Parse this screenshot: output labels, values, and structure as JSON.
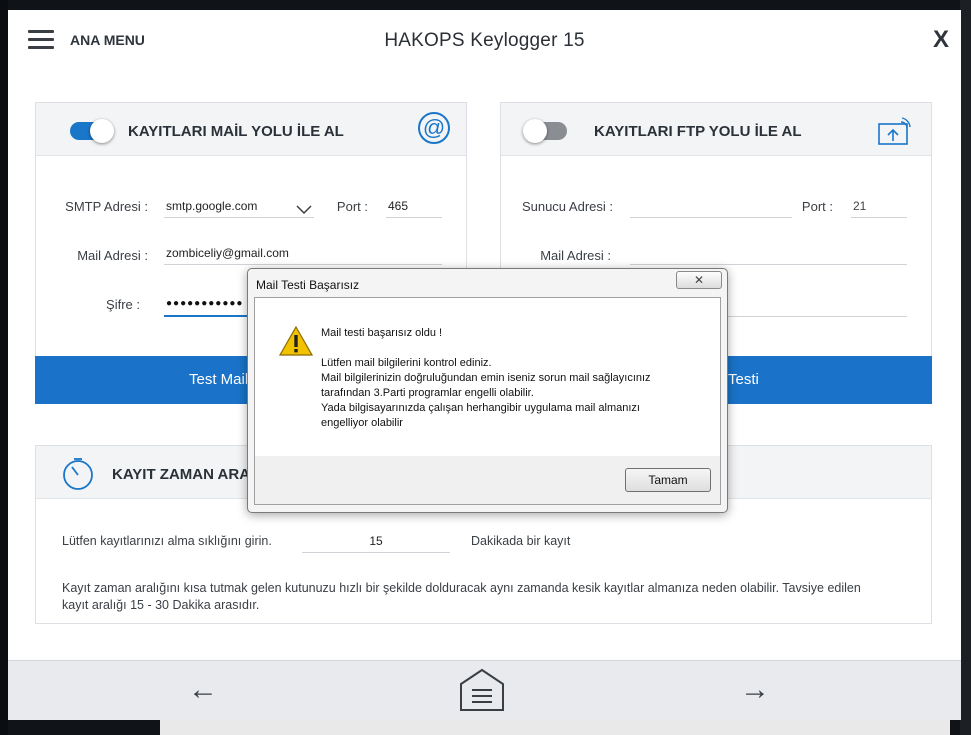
{
  "header": {
    "menu_label": "ANA MENU",
    "app_title": "HAKOPS Keylogger 15",
    "close_label": "X"
  },
  "mail_panel": {
    "title": "KAYITLARI MAİL YOLU İLE AL",
    "toggle_on": true,
    "icon_glyph": "@",
    "smtp_label": "SMTP Adresi :",
    "smtp_value": "smtp.google.com",
    "port_label": "Port :",
    "port_value": "465",
    "mail_label": "Mail Adresi :",
    "mail_value": "zombiceliy@gmail.com",
    "password_label": "Şifre :",
    "password_mask": "●●●●●●●●●●●",
    "test_button": "Test Mail"
  },
  "ftp_panel": {
    "title": "KAYITLARI FTP YOLU İLE AL",
    "toggle_on": false,
    "server_label": "Sunucu Adresi  :",
    "server_value": "",
    "port_label": "Port :",
    "port_value": "21",
    "mail_label": "Mail Adresi :",
    "mail_value": "",
    "test_button": "Testi"
  },
  "time_panel": {
    "title": "KAYIT ZAMAN ARA",
    "frequency_label": "Lütfen kayıtlarınızı alma sıklığını girin.",
    "frequency_value": "15",
    "frequency_unit": "Dakikada bir kayıt",
    "help_line1": "Kayıt zaman aralığını kısa tutmak gelen kutunuzu hızlı bir şekilde dolduracak aynı zamanda kesik kayıtlar almanıza neden olabilir. Tavsiye edilen",
    "help_line2": "kayıt aralığı 15 - 30 Dakika arasıdır."
  },
  "footer": {
    "back_glyph": "←",
    "forward_glyph": "→"
  },
  "dialog": {
    "title": "Mail Testi Başarısız",
    "close_glyph": "✕",
    "line1": "Mail testi başarısız oldu !",
    "line2": "Lütfen mail bilgilerini kontrol ediniz.",
    "line3": "Mail bilgilerinizin doğruluğundan emin iseniz sorun mail sağlayıcınız",
    "line4": "tarafından 3.Parti programlar engelli olabilir.",
    "line5": "Yada bilgisayarınızda çalışan herhangibir uygulama mail almanızı",
    "line6": "engelliyor olabilir",
    "ok_button": "Tamam"
  },
  "colors": {
    "accent": "#1a73c9",
    "panel_header": "#f2f4f6",
    "warning": "#f2c200"
  }
}
